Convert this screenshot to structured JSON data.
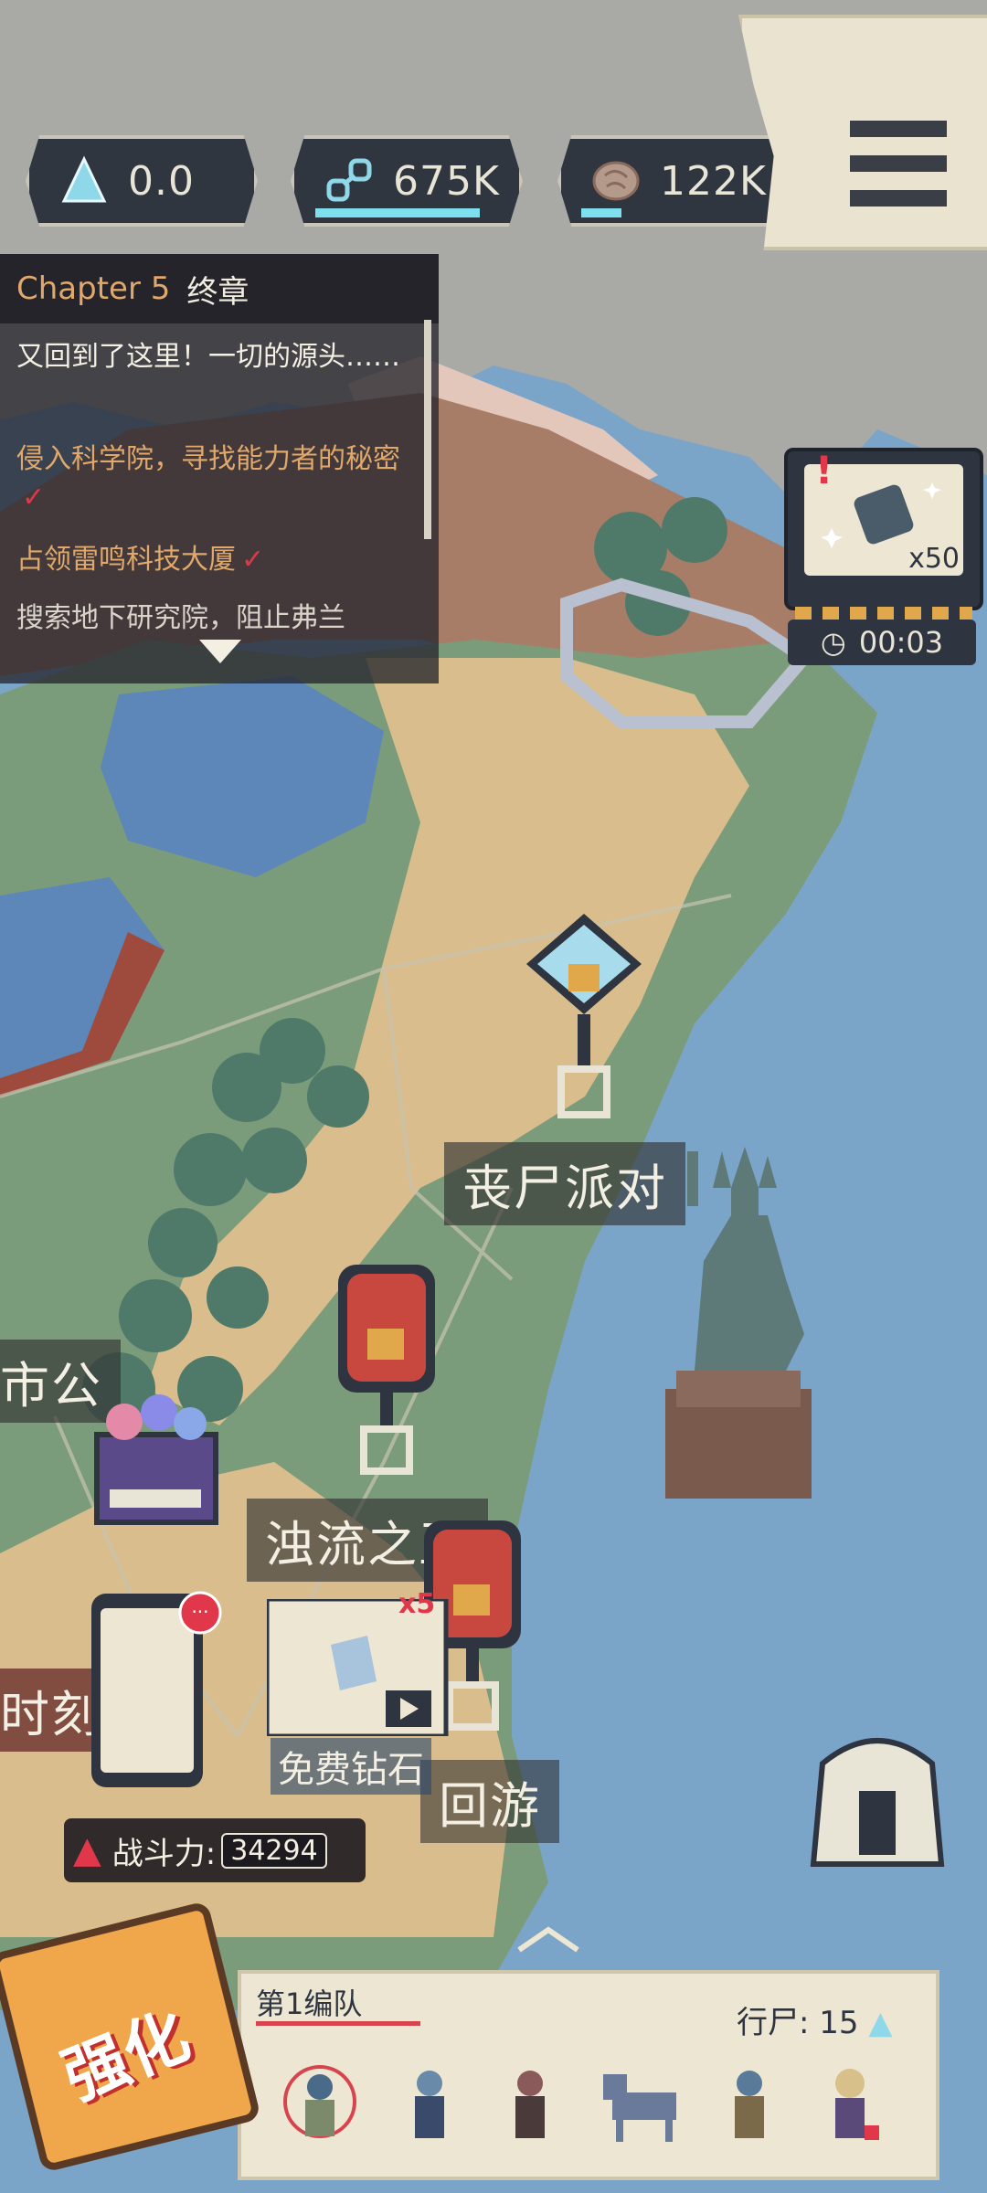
{
  "resources": [
    {
      "icon": "blue-crystal-icon",
      "value": "0.0"
    },
    {
      "icon": "chain-link-icon",
      "value": "675K"
    },
    {
      "icon": "brain-icon",
      "value": "122K"
    }
  ],
  "menu": {
    "icon": "hamburger-menu-icon"
  },
  "chapter": {
    "number": "Chapter 5",
    "name": "终章",
    "quests": [
      {
        "text": "又回到了这里！一切的源头……",
        "status": "active"
      },
      {
        "text": "侵入科学院，寻找能力者的秘密",
        "status": "done"
      },
      {
        "text": "占领雷鸣科技大厦",
        "status": "done"
      },
      {
        "text": "搜索地下研究院，阻止弗兰",
        "status": "active"
      }
    ]
  },
  "chest": {
    "count": "x50",
    "timer": "00:03"
  },
  "map_labels": {
    "zombie_party": "丧尸派对",
    "turbid_stream": "浊流之王",
    "left_partial_1": "市公",
    "left_partial_2": "时刻",
    "tour": "回游",
    "free_diamonds": "免费钻石",
    "gift_count": "x5"
  },
  "power": {
    "label": "战斗力:",
    "value": "34294"
  },
  "upgrade": {
    "label": "强化"
  },
  "team": {
    "name": "第1编队",
    "population_label": "行尸:",
    "population_value": "15",
    "units": [
      "unit-1",
      "unit-2",
      "unit-3",
      "unit-4",
      "unit-5",
      "unit-6"
    ]
  },
  "colors": {
    "accent": "#e0a86a",
    "alert": "#e0384a",
    "panel": "#2e3440",
    "cream": "#ece6d2"
  }
}
